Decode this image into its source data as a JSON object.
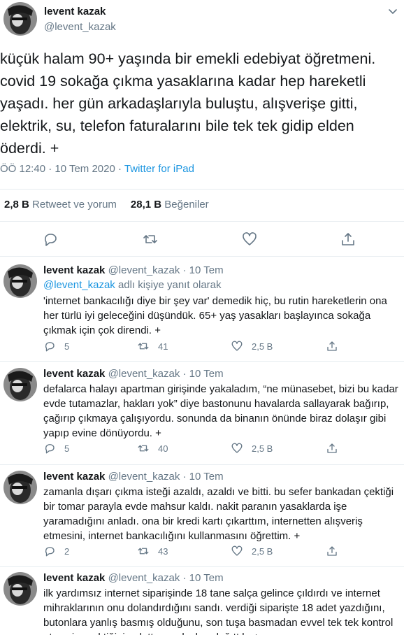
{
  "main": {
    "name": "levent kazak",
    "handle": "@levent_kazak",
    "text": "küçük halam 90+ yaşında bir emekli edebiyat öğretmeni. covid 19 sokağa çıkma yasaklarına kadar hep hareketli yaşadı. her gün arkadaşlarıyla buluştu, alışverişe gitti, elektrik, su, telefon faturalarını bile tek tek gidip elden öderdi. +",
    "time": "ÖÖ 12:40 · 10 Tem 2020 ·",
    "source": "Twitter for iPad",
    "retweets_count": "2,8 B",
    "retweets_label": "Retweet ve yorum",
    "likes_count": "28,1 B",
    "likes_label": "Beğeniler"
  },
  "replies": [
    {
      "name": "levent kazak",
      "meta": "@levent_kazak · 10 Tem",
      "reply_mention": "@levent_kazak",
      "reply_suffix": "adlı kişiye yanıt olarak",
      "text": "'internet bankacılığı diye bir şey var' demedik hiç, bu rutin hareketlerin ona her türlü iyi geleceğini düşündük. 65+ yaş yasakları başlayınca sokağa çıkmak için çok direndi. +",
      "replies": "5",
      "retweets": "41",
      "likes": "2,5 B"
    },
    {
      "name": "levent kazak",
      "meta": "@levent_kazak · 10 Tem",
      "text": "defalarca halayı apartman girişinde yakaladım, “ne münasebet, bizi bu kadar evde tutamazlar, hakları yok” diye bastonunu havalarda sallayarak bağırıp, çağırıp çıkmaya çalışıyordu. sonunda da binanın önünde biraz dolaşır gibi yapıp evine dönüyordu. +",
      "replies": "5",
      "retweets": "40",
      "likes": "2,5 B"
    },
    {
      "name": "levent kazak",
      "meta": "@levent_kazak · 10 Tem",
      "text": "zamanla dışarı çıkma isteği azaldı, azaldı ve bitti. bu sefer bankadan çektiği bir tomar parayla evde mahsur kaldı. nakit paranın yasaklarda işe yaramadığını anladı. ona bir kredi kartı çıkarttım, internetten alışveriş etmesini, internet bankacılığını kullanmasını öğrettim. +",
      "replies": "2",
      "retweets": "43",
      "likes": "2,5 B"
    },
    {
      "name": "levent kazak",
      "meta": "@levent_kazak · 10 Tem",
      "text": "ilk yardımsız internet siparişinde 18 tane salça gelince çıldırdı ve internet mihraklarının onu dolandırdığını sandı. verdiği siparişte 18 adet yazdığını, butonlara yanlış basmış olduğunu, son tuşa basmadan evvel tek tek kontrol etmesi gerektiğini anlattım, salçaları dağıttık. +"
    }
  ],
  "icons": {
    "reply": "reply-icon",
    "retweet": "retweet-icon",
    "like": "heart-icon",
    "share": "share-icon",
    "caret": "chevron-down-icon"
  },
  "colors": {
    "link": "#1b95e0",
    "secondary": "#657786",
    "divider": "#e6ecf0"
  }
}
